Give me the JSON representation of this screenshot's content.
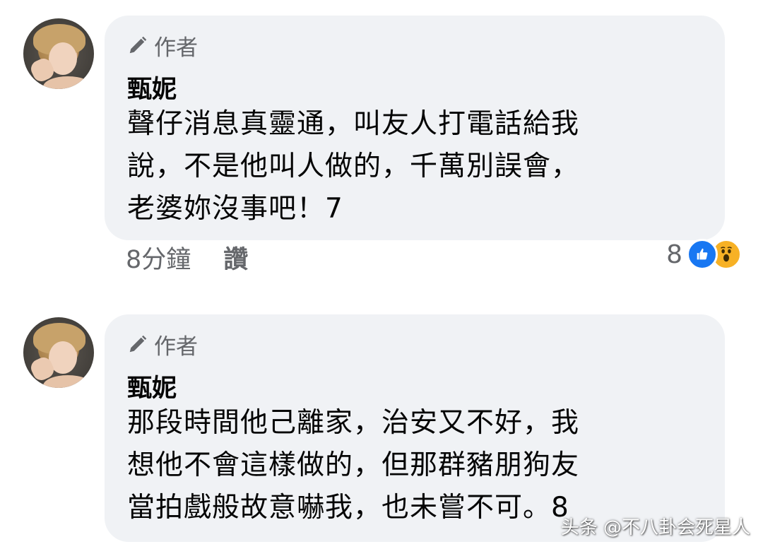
{
  "comments": [
    {
      "author_badge": "作者",
      "name": "甄妮",
      "lines": [
        "聲仔消息真靈通，叫友人打電話給我",
        "說，不是他叫人做的，千萬別誤會，",
        "老婆妳沒事吧！7"
      ],
      "time": "8分鐘",
      "like_label": "讚",
      "reaction_count": "8",
      "reaction_icons": [
        "like-icon",
        "wow-icon"
      ]
    },
    {
      "author_badge": "作者",
      "name": "甄妮",
      "lines": [
        "那段時間他己離家，治安又不好，我",
        "想他不會這樣做的，但那群豬朋狗友",
        "當拍戲般故意嚇我，也未嘗不可。8"
      ]
    }
  ],
  "watermark": "头条 @不八卦会死星人",
  "colors": {
    "bubble": "#f0f2f5",
    "meta_text": "#65676b",
    "like_blue": "#1877f2",
    "wow_yellow": "#f7b125"
  }
}
